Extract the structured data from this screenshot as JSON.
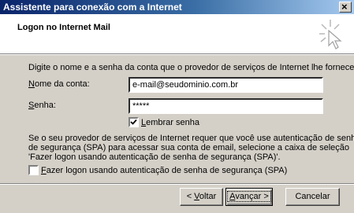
{
  "window": {
    "title": "Assistente para conexão com a Internet"
  },
  "header": {
    "title": "Logon no Internet Mail",
    "icon": "wizard-sparkle-cursor-icon"
  },
  "intro": "Digite o nome e a senha da conta que o provedor de serviços de Internet lhe forneceu.",
  "account": {
    "label_access": "N",
    "label_rest": "ome da conta:",
    "value": "e-mail@seudominio.com.br"
  },
  "password": {
    "label_access": "S",
    "label_rest": "enha:",
    "value": "*****"
  },
  "remember": {
    "label_access": "L",
    "label_rest": "embrar senha",
    "checked": true
  },
  "spa_text": {
    "line1": "Se o seu provedor de serviços de Internet requer que você use autenticação de senha",
    "line2": "de segurança (SPA) para acessar sua conta de email, selecione a caixa de seleção",
    "line3": "'Fazer logon usando autenticação de senha de segurança (SPA)'."
  },
  "spa_checkbox": {
    "label_access": "F",
    "label_rest": "azer logon usando autenticação de senha de segurança (SPA)",
    "checked": false
  },
  "buttons": {
    "back_prefix": "< ",
    "back_access": "V",
    "back_rest": "oltar",
    "next_access": "A",
    "next_rest": "vançar >",
    "cancel": "Cancelar"
  }
}
